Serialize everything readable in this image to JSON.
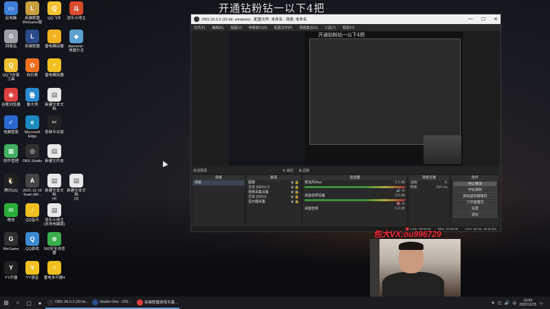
{
  "stream_title": "开通钻粉钻一以下4把",
  "vx_text": "包大VX:ou996729",
  "desktop_icons": [
    {
      "label": "此电脑",
      "color": "#3d7fd6",
      "glyph": "▭"
    },
    {
      "label": "英雄联盟\nWeGame版",
      "color": "#c9a040",
      "glyph": "L"
    },
    {
      "label": "QQ飞车",
      "color": "#f3c232",
      "glyph": "Q"
    },
    {
      "label": "双乐斗地主",
      "color": "#d94a2a",
      "glyph": "斗"
    },
    {
      "label": "回收站",
      "color": "#9aa0a6",
      "glyph": "♻"
    },
    {
      "label": "英雄联盟",
      "color": "#2a4a8a",
      "glyph": "L"
    },
    {
      "label": "雷电模拟器",
      "color": "#f0b020",
      "glyph": "⚡"
    },
    {
      "label": "diamond -\n快捷方式",
      "color": "#5aa0d0",
      "glyph": "◆"
    },
    {
      "label": "QQ飞车客\n工具",
      "color": "#f0c030",
      "glyph": "Q"
    },
    {
      "label": "向日葵",
      "color": "#f07020",
      "glyph": "✿"
    },
    {
      "label": "雷电模拟器",
      "color": "#f0c020",
      "glyph": "⚡"
    },
    {
      "label": "谷歌浏览器",
      "color": "#e04040",
      "glyph": "◉"
    },
    {
      "label": "鲁大师",
      "color": "#2a8ad0",
      "glyph": "鲁"
    },
    {
      "label": "新建文本文档",
      "color": "#e8e8e8",
      "glyph": "▤"
    },
    {
      "label": "电脑管家",
      "color": "#2a6ad0",
      "glyph": "✓"
    },
    {
      "label": "Microsoft\nEdge",
      "color": "#1a8ac0",
      "glyph": "e"
    },
    {
      "label": "剪映专业版",
      "color": "#222222",
      "glyph": "✂"
    },
    {
      "label": "软件管理",
      "color": "#40b060",
      "glyph": "▦"
    },
    {
      "label": "OBS Studio",
      "color": "#303030",
      "glyph": "◎"
    },
    {
      "label": "新建文件夹",
      "color": "#e8e8e8",
      "glyph": "▤"
    },
    {
      "label": "腾讯QQ",
      "color": "#202020",
      "glyph": "🐧"
    },
    {
      "label": "2021-11-19\nTeam AR...",
      "color": "#444444",
      "glyph": "A"
    },
    {
      "label": "新建文本文档\n(4)",
      "color": "#e8e8e8",
      "glyph": "▤"
    },
    {
      "label": "新建文本文档\n(3)",
      "color": "#e8e8e8",
      "glyph": "▤"
    },
    {
      "label": "微信",
      "color": "#2aae3a",
      "glyph": "✉"
    },
    {
      "label": "QQ音乐",
      "color": "#f0c020",
      "glyph": "♪"
    },
    {
      "label": "双乐斗地主\n(本地电脑版)",
      "color": "#e8e8e8",
      "glyph": "▤"
    },
    {
      "label": "WeGame",
      "color": "#303030",
      "glyph": "G"
    },
    {
      "label": "QQ游戏",
      "color": "#3a8ad0",
      "glyph": "Q"
    },
    {
      "label": "360安全浏览\n器",
      "color": "#3aae4a",
      "glyph": "⊕"
    },
    {
      "label": "YY开播",
      "color": "#202020",
      "glyph": "Y"
    },
    {
      "label": "YY语音",
      "color": "#f0c020",
      "glyph": "Y"
    },
    {
      "label": "雷电多开器4",
      "color": "#f0c020",
      "glyph": "⚡"
    }
  ],
  "obs": {
    "title": "OBS 26.0.2 (32-bit, windows) - 配置文件: 未命名 - 场景: 未命名",
    "menu": [
      "文件(F)",
      "编辑(E)",
      "视图(V)",
      "停靠窗口(D)",
      "配置文件(P)",
      "场景集合(S)",
      "工具(T)",
      "帮助(H)"
    ],
    "preview_title": "开通钻粉钻一以下4把",
    "scenebar_left": "未选择源",
    "scenebar_props": "⚙ 属性",
    "scenebar_filters": "⧉ 滤镜",
    "docks": {
      "scenes": {
        "title": "场景",
        "items": [
          "场景"
        ]
      },
      "sources": {
        "title": "来源",
        "items": [
          "图像",
          "文本 (GDI+) 2",
          "视频采集设备",
          "文本 (GDI+)",
          "显示器采集"
        ]
      },
      "mixer": {
        "title": "混音器",
        "channels": [
          {
            "name": "麦克风/Aux",
            "db": "0.0 dB"
          },
          {
            "name": "桌面音频设备",
            "db": "0.0 dB"
          },
          {
            "name": "桌面音频",
            "db": "0.0 dB"
          }
        ]
      },
      "transitions": {
        "title": "场景过渡",
        "type": "淡出",
        "duration_label": "时长",
        "duration": "300 ms"
      },
      "controls": {
        "title": "控件",
        "buttons": [
          "停止推流",
          "开始录制",
          "启动虚拟摄像机",
          "工作室模式",
          "设置",
          "退出"
        ]
      }
    },
    "status": {
      "live": "LIVE: 00:00:00",
      "rec": "REC: 00:00:00",
      "cpu": "CPU: 40.0%, 40.00 fps"
    }
  },
  "taskbar": {
    "tasks": [
      {
        "label": "OBS 26.0.2 (32-bi...",
        "color": "#303030",
        "active": true
      },
      {
        "label": "Studio One - 202...",
        "color": "#2a4a8a",
        "active": true
      },
      {
        "label": "英雄联盟游戏专属...",
        "color": "#e04040",
        "active": true
      }
    ],
    "time": "16:59",
    "date": "2022/12/15"
  }
}
